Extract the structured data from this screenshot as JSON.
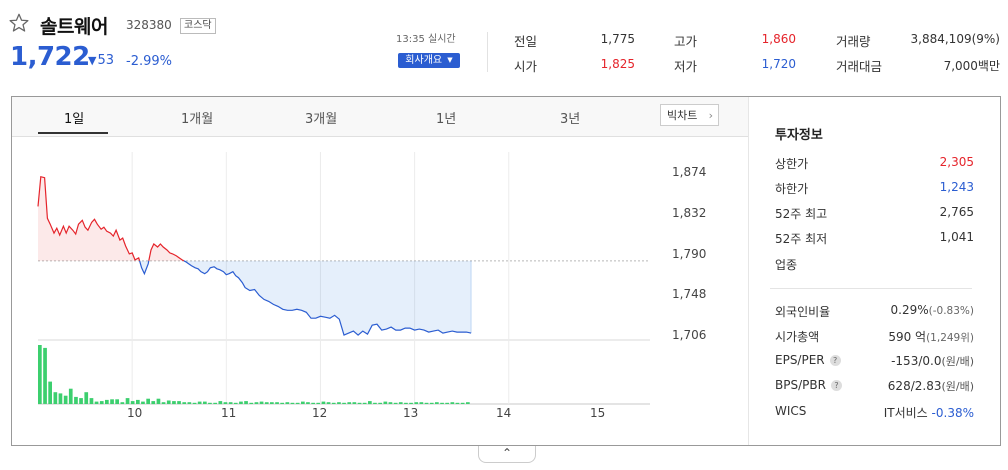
{
  "stock": {
    "name": "솔트웨어",
    "code": "328380",
    "market": "코스닥",
    "price": "1,722",
    "change": "53",
    "change_rate": "-2.99%",
    "time": "13:35 실시간",
    "company_button": "회사개요"
  },
  "quotes": {
    "prev_close_label": "전일",
    "prev_close": "1,775",
    "open_label": "시가",
    "open": "1,825",
    "high_label": "고가",
    "high": "1,860",
    "low_label": "저가",
    "low": "1,720",
    "volume_label": "거래량",
    "volume": "3,884,109(9%)",
    "amount_label": "거래대금",
    "amount": "7,000백만"
  },
  "tabs": [
    "1일",
    "1개월",
    "3개월",
    "1년",
    "3년"
  ],
  "bigchart_label": "빅차트",
  "investment": {
    "title": "투자정보",
    "upper_limit_label": "상한가",
    "upper_limit": "2,305",
    "lower_limit_label": "하한가",
    "lower_limit": "1,243",
    "week52_high_label": "52주 최고",
    "week52_high": "2,765",
    "week52_low_label": "52주 최저",
    "week52_low": "1,041",
    "sector_label": "업종",
    "foreign_label": "외국인비율",
    "foreign": "0.29%",
    "foreign_change": "(-0.83%)",
    "market_cap_label": "시가총액",
    "market_cap": "590 억",
    "market_cap_sub": "(1,249위)",
    "eps_per_label": "EPS/PER",
    "eps_per": "-153/0.0",
    "eps_per_unit": "(원/배)",
    "bps_pbr_label": "BPS/PBR",
    "bps_pbr": "628/2.83",
    "bps_pbr_unit": "(원/배)",
    "wics_label": "WICS",
    "wics": "IT서비스",
    "wics_change": "-0.38%"
  },
  "colors": {
    "up": "#e5242b",
    "down": "#2b5dd1",
    "volume": "#3ccf6e"
  },
  "chart_data": {
    "type": "line",
    "reference_price": 1775,
    "ylim": [
      1695,
      1885
    ],
    "y_ticks": [
      "1,874",
      "1,832",
      "1,790",
      "1,748",
      "1,706"
    ],
    "x_ticks": [
      "10",
      "11",
      "12",
      "13",
      "14",
      "15"
    ],
    "x_range": [
      9.0,
      15.5
    ],
    "price_series": {
      "x": [
        9.0,
        9.03,
        9.07,
        9.1,
        9.13,
        9.17,
        9.2,
        9.23,
        9.27,
        9.3,
        9.33,
        9.37,
        9.4,
        9.43,
        9.47,
        9.5,
        9.53,
        9.57,
        9.6,
        9.63,
        9.67,
        9.7,
        9.73,
        9.77,
        9.8,
        9.83,
        9.87,
        9.9,
        9.93,
        9.97,
        10.0,
        10.03,
        10.07,
        10.1,
        10.13,
        10.17,
        10.2,
        10.23,
        10.27,
        10.3,
        10.33,
        10.37,
        10.4,
        10.43,
        10.47,
        10.5,
        10.53,
        10.57,
        10.6,
        10.63,
        10.67,
        10.7,
        10.73,
        10.77,
        10.8,
        10.83,
        10.87,
        10.9,
        10.93,
        10.97,
        11.0,
        11.03,
        11.07,
        11.1,
        11.13,
        11.17,
        11.2,
        11.25,
        11.3,
        11.35,
        11.4,
        11.45,
        11.5,
        11.55,
        11.6,
        11.65,
        11.7,
        11.75,
        11.8,
        11.85,
        11.9,
        11.95,
        12.0,
        12.05,
        12.1,
        12.15,
        12.2,
        12.25,
        12.3,
        12.35,
        12.4,
        12.45,
        12.5,
        12.55,
        12.6,
        12.65,
        12.7,
        12.75,
        12.8,
        12.85,
        12.9,
        12.95,
        13.0,
        13.05,
        13.1,
        13.15,
        13.2,
        13.25,
        13.3,
        13.35,
        13.4,
        13.45,
        13.5,
        13.55,
        13.6
      ],
      "y": [
        1830,
        1860,
        1859,
        1818,
        1812,
        1803,
        1808,
        1801,
        1810,
        1803,
        1810,
        1806,
        1802,
        1812,
        1816,
        1809,
        1806,
        1814,
        1817,
        1812,
        1807,
        1809,
        1805,
        1803,
        1800,
        1806,
        1796,
        1798,
        1790,
        1782,
        1783,
        1776,
        1778,
        1768,
        1762,
        1772,
        1786,
        1792,
        1789,
        1792,
        1789,
        1786,
        1783,
        1782,
        1780,
        1778,
        1776,
        1774,
        1772,
        1770,
        1768,
        1767,
        1764,
        1762,
        1764,
        1768,
        1769,
        1767,
        1766,
        1764,
        1761,
        1762,
        1764,
        1760,
        1758,
        1753,
        1748,
        1745,
        1746,
        1740,
        1736,
        1734,
        1731,
        1729,
        1726,
        1725,
        1725,
        1726,
        1725,
        1723,
        1717,
        1717,
        1719,
        1718,
        1717,
        1720,
        1716,
        1700,
        1702,
        1704,
        1700,
        1704,
        1701,
        1710,
        1711,
        1705,
        1706,
        1708,
        1705,
        1705,
        1707,
        1707,
        1705,
        1706,
        1705,
        1703,
        1704,
        1705,
        1702,
        1703,
        1704,
        1703,
        1703,
        1703,
        1702
      ]
    },
    "volume_series": [
      100,
      95,
      38,
      20,
      18,
      14,
      26,
      12,
      10,
      20,
      10,
      4,
      5,
      7,
      8,
      8,
      3,
      10,
      5,
      7,
      4,
      9,
      5,
      9,
      3,
      6,
      5,
      5,
      3,
      3,
      2,
      4,
      4,
      2,
      2,
      5,
      3,
      3,
      2,
      4,
      5,
      2,
      3,
      4,
      3,
      3,
      3,
      2,
      3,
      2,
      2,
      4,
      3,
      2,
      2,
      4,
      3,
      2,
      3,
      2,
      3,
      3,
      2,
      2,
      5,
      2,
      2,
      4,
      3,
      2,
      3,
      2,
      2,
      3,
      3,
      2,
      2,
      3,
      2,
      2,
      3,
      2,
      2,
      3
    ]
  }
}
